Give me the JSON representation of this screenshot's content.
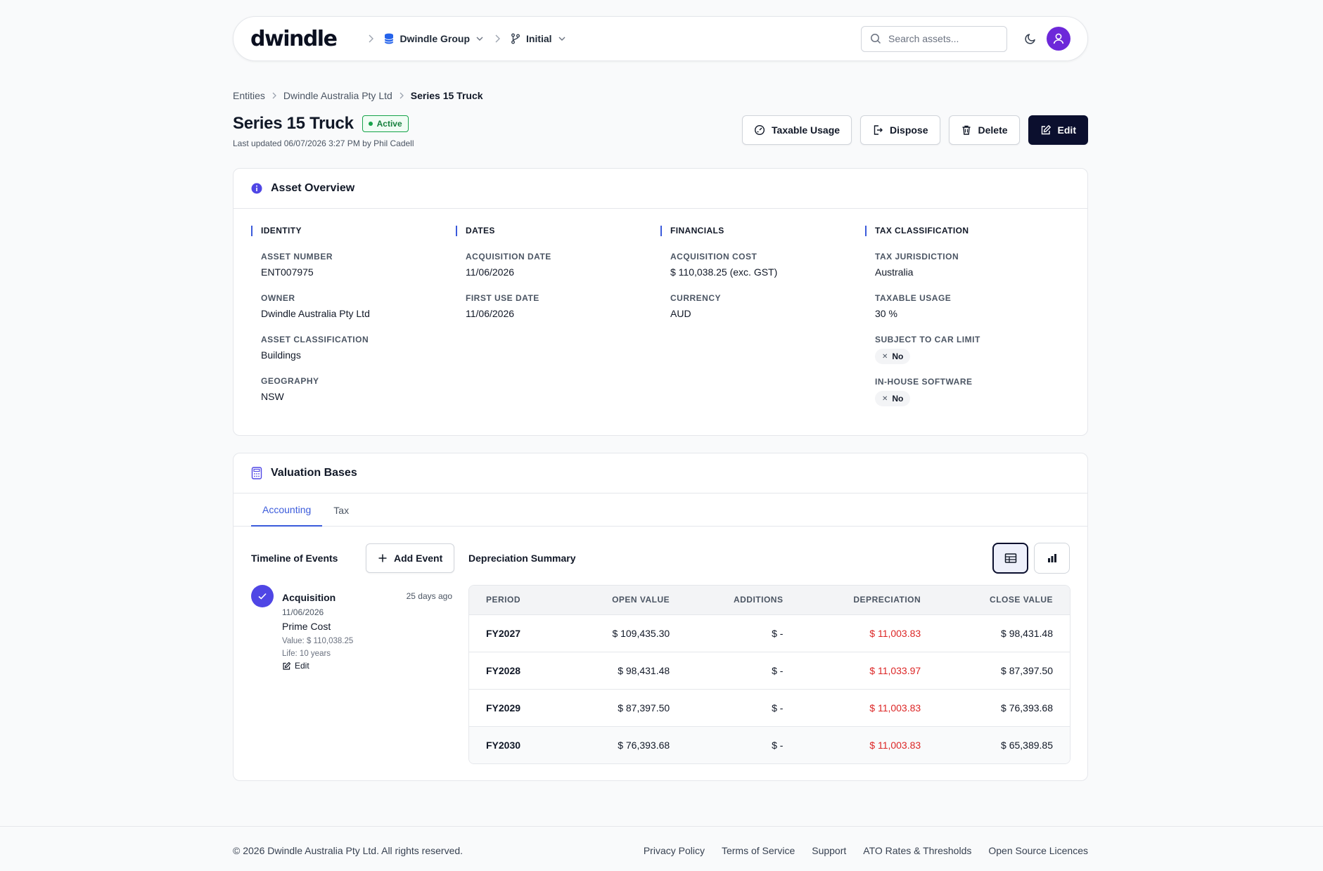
{
  "nav": {
    "logo": "dwindle",
    "org": "Dwindle Group",
    "branch": "Initial",
    "search_placeholder": "Search assets..."
  },
  "breadcrumb": {
    "items": [
      "Entities",
      "Dwindle Australia Pty Ltd"
    ],
    "current": "Series 15 Truck"
  },
  "header": {
    "title": "Series 15 Truck",
    "status": "Active",
    "last_updated": "Last updated 06/07/2026 3:27 PM by Phil Cadell",
    "actions": {
      "taxable_usage": "Taxable Usage",
      "dispose": "Dispose",
      "delete": "Delete",
      "edit": "Edit"
    }
  },
  "overview": {
    "title": "Asset Overview",
    "identity": {
      "heading": "IDENTITY",
      "asset_number_label": "ASSET NUMBER",
      "asset_number": "ENT007975",
      "owner_label": "OWNER",
      "owner": "Dwindle Australia Pty Ltd",
      "classification_label": "ASSET CLASSIFICATION",
      "classification": "Buildings",
      "geography_label": "GEOGRAPHY",
      "geography": "NSW"
    },
    "dates": {
      "heading": "DATES",
      "acquisition_label": "ACQUISITION DATE",
      "acquisition": "11/06/2026",
      "first_use_label": "FIRST USE DATE",
      "first_use": "11/06/2026"
    },
    "financials": {
      "heading": "FINANCIALS",
      "cost_label": "ACQUISITION COST",
      "cost": "$ 110,038.25 (exc. GST)",
      "currency_label": "CURRENCY",
      "currency": "AUD"
    },
    "tax": {
      "heading": "TAX CLASSIFICATION",
      "jurisdiction_label": "TAX JURISDICTION",
      "jurisdiction": "Australia",
      "usage_label": "TAXABLE USAGE",
      "usage": "30 %",
      "car_limit_label": "SUBJECT TO CAR LIMIT",
      "car_limit": "No",
      "software_label": "IN-HOUSE SOFTWARE",
      "software": "No"
    }
  },
  "valuation": {
    "title": "Valuation Bases",
    "tabs": [
      "Accounting",
      "Tax"
    ],
    "timeline_title": "Timeline of Events",
    "add_event": "Add Event",
    "event": {
      "title": "Acquisition",
      "ago": "25 days ago",
      "date": "11/06/2026",
      "method": "Prime Cost",
      "value": "Value: $ 110,038.25",
      "life": "Life: 10 years",
      "edit": "Edit"
    },
    "summary_title": "Depreciation Summary",
    "columns": [
      "PERIOD",
      "OPEN VALUE",
      "ADDITIONS",
      "DEPRECIATION",
      "CLOSE VALUE"
    ],
    "rows": [
      [
        "FY2027",
        "$ 109,435.30",
        "$ -",
        "$ 11,003.83",
        "$ 98,431.48"
      ],
      [
        "FY2028",
        "$ 98,431.48",
        "$ -",
        "$ 11,033.97",
        "$ 87,397.50"
      ],
      [
        "FY2029",
        "$ 87,397.50",
        "$ -",
        "$ 11,003.83",
        "$ 76,393.68"
      ],
      [
        "FY2030",
        "$ 76,393.68",
        "$ -",
        "$ 11,003.83",
        "$ 65,389.85"
      ]
    ]
  },
  "footer": {
    "copyright": "© 2026 Dwindle Australia Pty Ltd. All rights reserved.",
    "links": [
      "Privacy Policy",
      "Terms of Service",
      "Support",
      "ATO Rates & Thresholds",
      "Open Source Licences"
    ]
  },
  "colors": {
    "accent": "#3b5bdb",
    "primary": "#0b0f2e",
    "negative": "#dc2626",
    "success": "#16a34a"
  }
}
